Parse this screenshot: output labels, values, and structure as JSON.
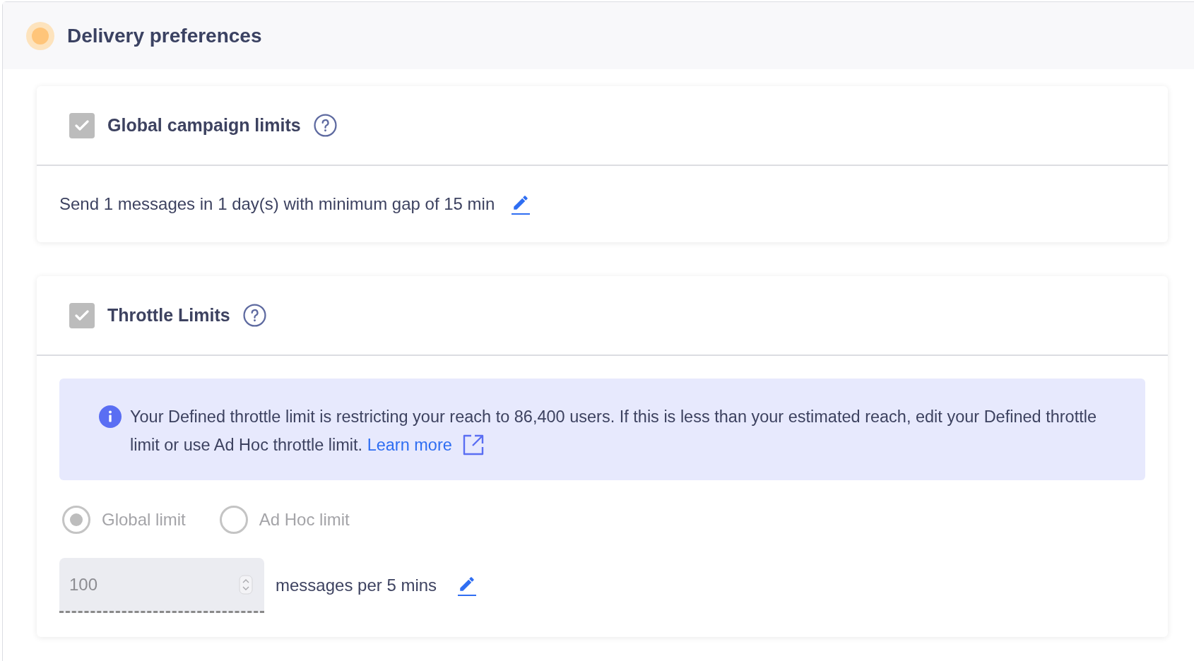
{
  "section": {
    "title": "Delivery preferences"
  },
  "cards": [
    {
      "kind": "global",
      "title": "Global campaign limits",
      "checked": true,
      "disabled": true,
      "summary": "Send 1 messages in 1 day(s) with minimum gap of 15 min"
    },
    {
      "kind": "throttle",
      "title": "Throttle Limits",
      "checked": true,
      "disabled": true,
      "info": {
        "text": "Your Defined throttle limit is restricting your reach to 86,400 users. If this is less than your estimated reach, edit your Defined throttle limit or use Ad Hoc throttle limit.",
        "link": "Learn more"
      },
      "options": [
        {
          "label": "Global limit",
          "selected": true,
          "disabled": true
        },
        {
          "label": "Ad Hoc limit",
          "selected": false,
          "disabled": true
        }
      ],
      "limit": {
        "value": "100",
        "disabled": true,
        "unit": "messages per 5 mins"
      }
    }
  ]
}
